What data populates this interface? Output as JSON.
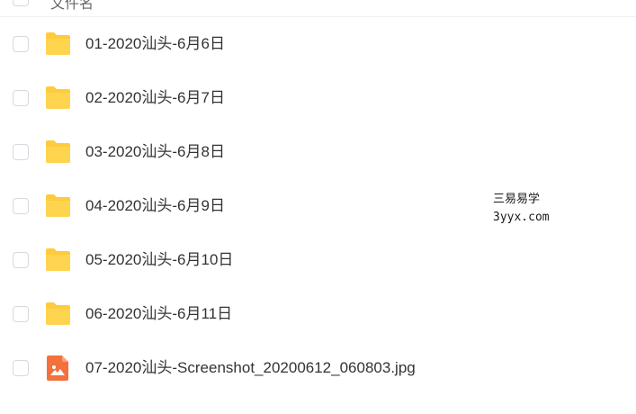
{
  "header": {
    "column_label": "文件名"
  },
  "files": [
    {
      "name": "01-2020汕头-6月6日",
      "type": "folder",
      "icon": "folder-icon"
    },
    {
      "name": "02-2020汕头-6月7日",
      "type": "folder",
      "icon": "folder-icon"
    },
    {
      "name": "03-2020汕头-6月8日",
      "type": "folder",
      "icon": "folder-icon"
    },
    {
      "name": "04-2020汕头-6月9日",
      "type": "folder",
      "icon": "folder-icon"
    },
    {
      "name": "05-2020汕头-6月10日",
      "type": "folder",
      "icon": "folder-icon"
    },
    {
      "name": "06-2020汕头-6月11日",
      "type": "folder",
      "icon": "folder-icon"
    },
    {
      "name": "07-2020汕头-Screenshot_20200612_060803.jpg",
      "type": "image",
      "icon": "image-file-icon"
    }
  ],
  "watermark": {
    "line1": "三易易学",
    "line2": "3yyx.com"
  },
  "colors": {
    "folder": "#ffcb3d",
    "image_file": "#f2713c",
    "checkbox_border": "#d6d9de"
  }
}
